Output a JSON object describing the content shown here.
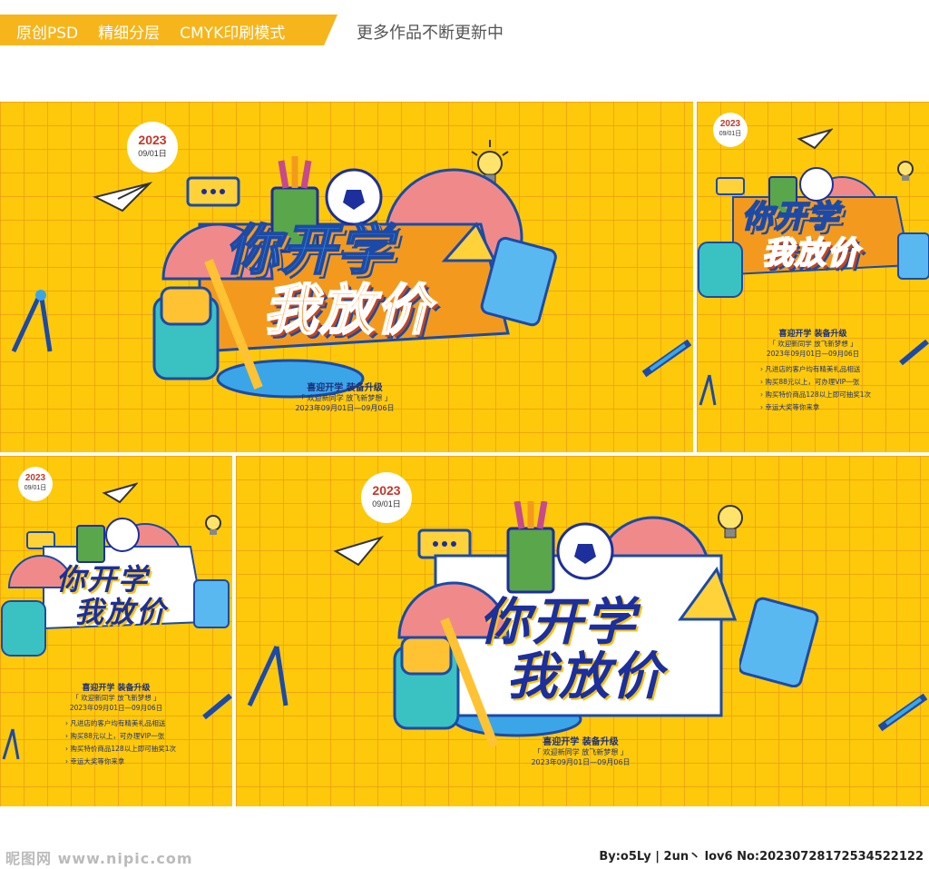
{
  "header": {
    "tags": [
      "原创PSD",
      "精细分层",
      "CMYK印刷模式"
    ],
    "note": "更多作品不断更新中"
  },
  "poster": {
    "badge_year": "2023",
    "badge_date": "09/01日",
    "headline_line1": "你开学",
    "headline_line2": "我放价",
    "subtitle": "喜迎开学 装备升级",
    "slogan": "「 欢迎新同学 放飞新梦想 」",
    "dates": "2023年09月01日—09月06日",
    "offers": [
      "凡进店的客户均有精美礼品相送",
      "购买88元以上，可办理VIP一张",
      "购买特价商品128以上即可抽奖1次",
      "幸运大奖等你来拿"
    ]
  },
  "colors": {
    "background": "#fdc90a",
    "grid": "#e88c14",
    "navy": "#1c2f9c",
    "accent_orange": "#ff8a1a",
    "accent_blue": "#3aa6e8"
  },
  "footer": {
    "left": "昵图网 www.nipic.com",
    "right": "By:o5Ly | 2un丶 lov6 No:20230728172534522122"
  }
}
